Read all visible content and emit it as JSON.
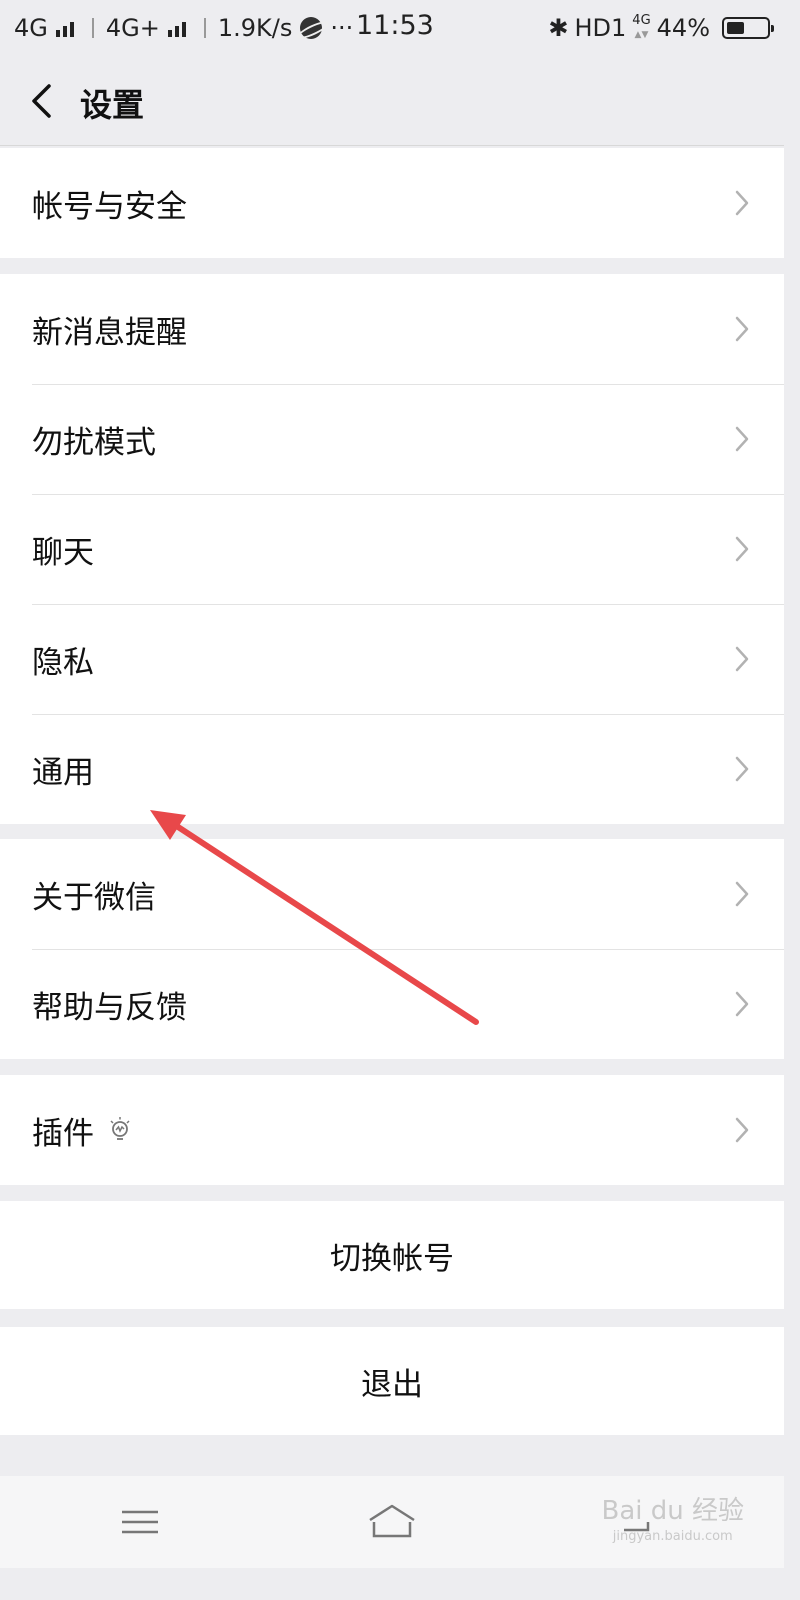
{
  "status_bar": {
    "net1": "4G",
    "net2": "4G+",
    "speed": "1.9K/s",
    "more": "···",
    "time": "11:53",
    "bt": "✱",
    "hd": "HD1",
    "tiny_net": "4G",
    "battery_pct": "44%",
    "battery_level": 0.44
  },
  "header": {
    "title": "设置"
  },
  "groups": {
    "account": [
      "帐号与安全"
    ],
    "main": [
      "新消息提醒",
      "勿扰模式",
      "聊天",
      "隐私",
      "通用"
    ],
    "about": [
      "关于微信",
      "帮助与反馈"
    ],
    "plugins": [
      "插件"
    ]
  },
  "actions": {
    "switch_account": "切换帐号",
    "logout": "退出"
  },
  "watermark": {
    "brand": "Bai du 经验",
    "url": "jingyan.baidu.com"
  },
  "colors": {
    "background": "#ededf0",
    "annotation_arrow": "#e8484a",
    "chevron": "#b2b2b2"
  }
}
